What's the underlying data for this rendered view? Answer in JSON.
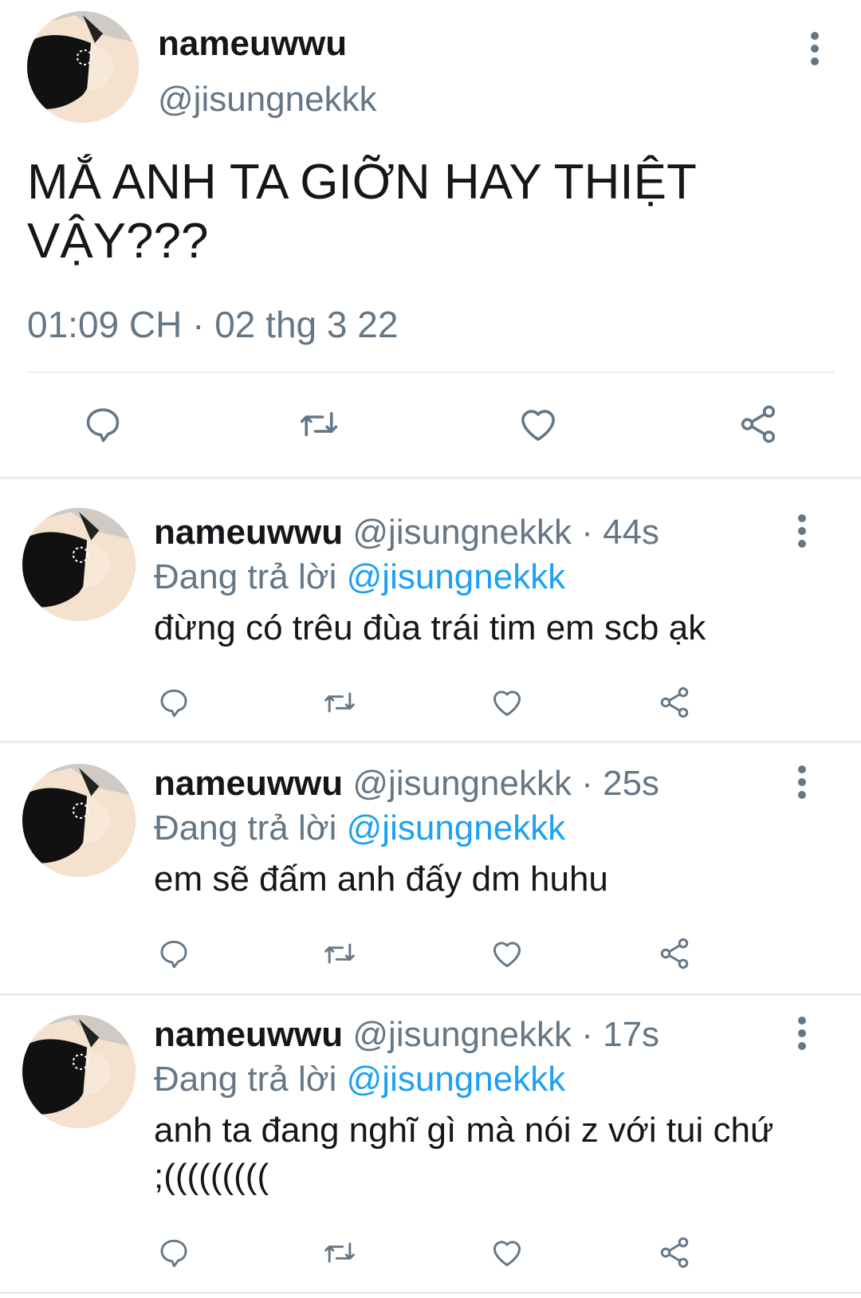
{
  "main_tweet": {
    "display_name": "nameuwwu",
    "handle": "@jisungnekkk",
    "text": "MẮ ANH TA GIỠN HAY THIỆT VẬY???",
    "timestamp": "01:09 CH · 02 thg 3 22"
  },
  "actions": {
    "reply_icon": "reply-icon",
    "retweet_icon": "retweet-icon",
    "like_icon": "heart-icon",
    "share_icon": "share-icon"
  },
  "replies": [
    {
      "display_name": "nameuwwu",
      "handle": "@jisungnekkk",
      "dot": "·",
      "time": "44s",
      "replying_label": "Đang trả lời",
      "replying_to": "@jisungnekkk",
      "text": "đừng có trêu đùa trái tim em scb ạk"
    },
    {
      "display_name": "nameuwwu",
      "handle": "@jisungnekkk",
      "dot": "·",
      "time": "25s",
      "replying_label": "Đang trả lời",
      "replying_to": "@jisungnekkk",
      "text": "em sẽ đấm anh đấy dm huhu"
    },
    {
      "display_name": "nameuwwu",
      "handle": "@jisungnekkk",
      "dot": "·",
      "time": "17s",
      "replying_label": "Đang trả lời",
      "replying_to": "@jisungnekkk",
      "text": "anh ta đang nghĩ gì mà nói z với tui chứ ;((((((((("
    }
  ],
  "colors": {
    "text": "#14171a",
    "secondary": "#657786",
    "link": "#1da1f2",
    "divider": "#e6ecf0"
  }
}
